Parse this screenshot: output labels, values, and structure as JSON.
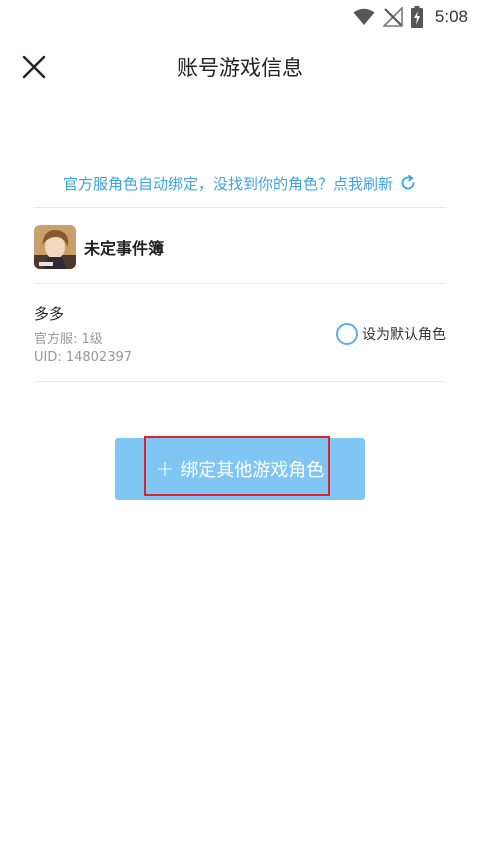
{
  "status_bar": {
    "time": "5:08",
    "icons": [
      "wifi-icon",
      "no-signal-icon",
      "battery-charging-icon"
    ]
  },
  "header": {
    "title": "账号游戏信息",
    "close_icon": "close-icon"
  },
  "refresh": {
    "text": "官方服角色自动绑定，没找到你的角色？点我刷新",
    "icon": "refresh-icon",
    "color": "#3aa3e3"
  },
  "game": {
    "name": "未定事件簿",
    "icon": "game-app-icon"
  },
  "role": {
    "name": "多多",
    "server": "官方服: 1级",
    "uid": "UID: 14802397",
    "default_label": "设为默认角色"
  },
  "bind_button": {
    "plus": "+",
    "label": "绑定其他游戏角色",
    "color": "#7fc6f5"
  },
  "highlight": {
    "color": "#e0202a"
  }
}
